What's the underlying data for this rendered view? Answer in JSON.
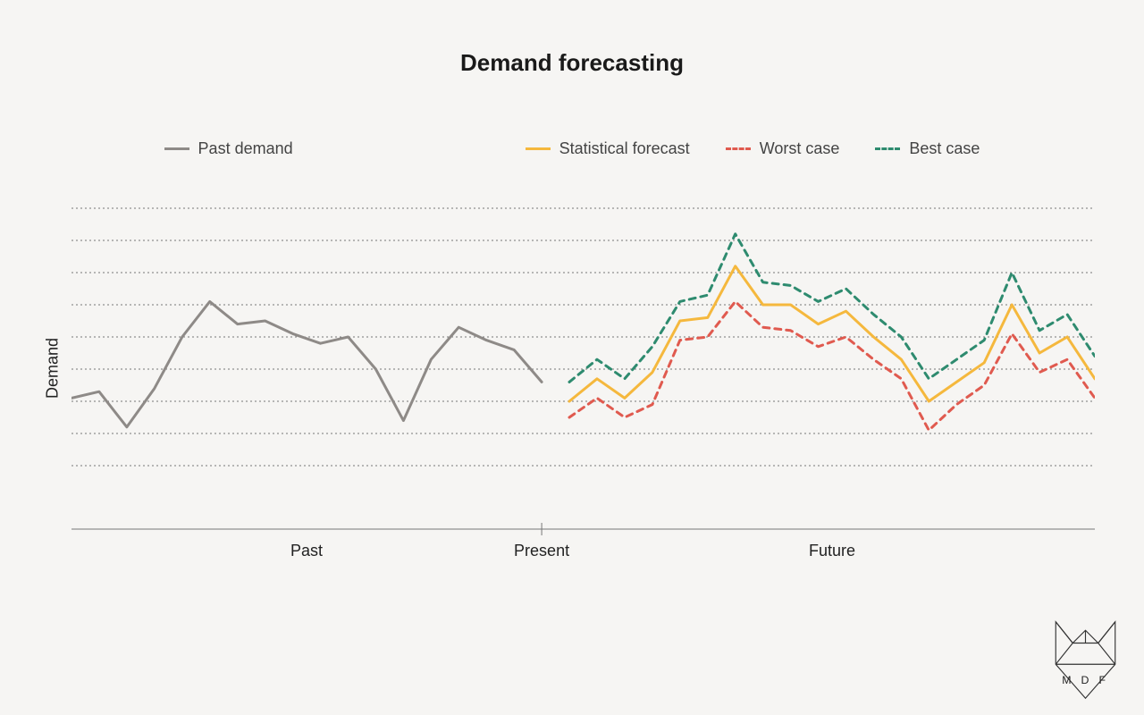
{
  "title": "Demand forecasting",
  "ylabel": "Demand",
  "x_sections": {
    "past": "Past",
    "present": "Present",
    "future": "Future"
  },
  "legend": {
    "past": {
      "label": "Past demand",
      "color": "#8e8a87",
      "style": "solid"
    },
    "stat": {
      "label": "Statistical forecast",
      "color": "#f5b83d",
      "style": "solid"
    },
    "worst": {
      "label": "Worst case",
      "color": "#e05a4f",
      "style": "dashed"
    },
    "best": {
      "label": "Best case",
      "color": "#2e8b6f",
      "style": "dashed"
    }
  },
  "logo_text": "M D F",
  "chart_data": {
    "type": "line",
    "title": "Demand forecasting",
    "ylabel": "Demand",
    "xlabel": "",
    "ylim": [
      0,
      10
    ],
    "grid": true,
    "legend_position": "top",
    "x": [
      0,
      1,
      2,
      3,
      4,
      5,
      6,
      7,
      8,
      9,
      10,
      11,
      12,
      13,
      14,
      15,
      16,
      17,
      18,
      19,
      20,
      21,
      22,
      23,
      24,
      25,
      26,
      27,
      28,
      29,
      30,
      31,
      32,
      33,
      34,
      35,
      36,
      37
    ],
    "x_annotations": {
      "Past": 8.5,
      "Present": 17,
      "Future": 27.5
    },
    "series": [
      {
        "name": "Past demand",
        "color": "#8e8a87",
        "style": "solid",
        "range": [
          0,
          17
        ],
        "values": [
          3.1,
          3.3,
          2.2,
          3.4,
          5.0,
          6.1,
          5.4,
          5.5,
          5.1,
          4.8,
          5.0,
          4.0,
          2.4,
          4.3,
          5.3,
          4.9,
          4.6,
          3.6
        ]
      },
      {
        "name": "Statistical forecast",
        "color": "#f5b83d",
        "style": "solid",
        "range": [
          18,
          37
        ],
        "values": [
          3.0,
          3.7,
          3.1,
          3.9,
          5.5,
          5.6,
          7.2,
          6.0,
          6.0,
          5.4,
          5.8,
          5.0,
          4.3,
          3.0,
          3.6,
          4.2,
          6.0,
          4.5,
          5.0,
          3.7
        ]
      },
      {
        "name": "Worst case",
        "color": "#e05a4f",
        "style": "dashed",
        "range": [
          18,
          37
        ],
        "values": [
          2.5,
          3.1,
          2.5,
          2.9,
          4.9,
          5.0,
          6.1,
          5.3,
          5.2,
          4.7,
          5.0,
          4.3,
          3.7,
          2.1,
          2.9,
          3.5,
          5.1,
          3.9,
          4.3,
          3.1
        ]
      },
      {
        "name": "Best case",
        "color": "#2e8b6f",
        "style": "dashed",
        "range": [
          18,
          37
        ],
        "values": [
          3.6,
          4.3,
          3.7,
          4.7,
          6.1,
          6.3,
          8.2,
          6.7,
          6.6,
          6.1,
          6.5,
          5.7,
          5.0,
          3.7,
          4.3,
          4.9,
          7.0,
          5.2,
          5.7,
          4.4
        ]
      }
    ]
  }
}
